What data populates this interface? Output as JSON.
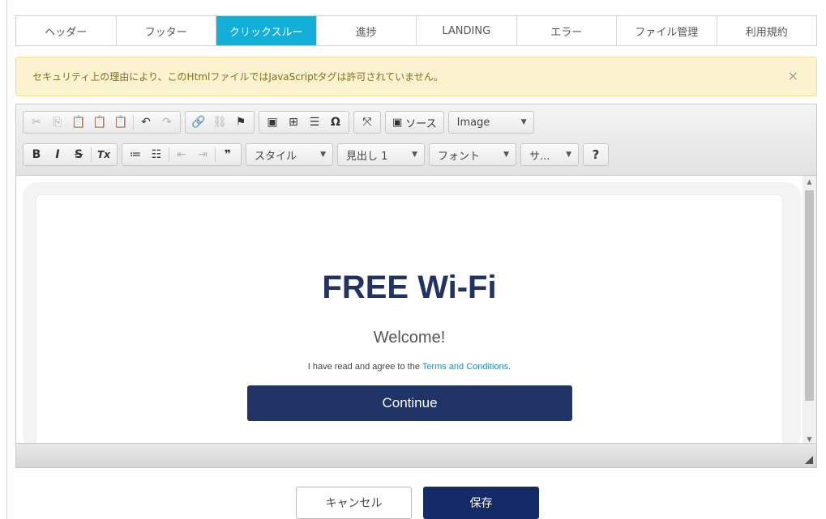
{
  "tabs": [
    {
      "label": "ヘッダー",
      "active": false
    },
    {
      "label": "フッター",
      "active": false
    },
    {
      "label": "クリックスルー",
      "active": true
    },
    {
      "label": "進捗",
      "active": false
    },
    {
      "label": "LANDING",
      "active": false
    },
    {
      "label": "エラー",
      "active": false
    },
    {
      "label": "ファイル管理",
      "active": false
    },
    {
      "label": "利用規約",
      "active": false
    }
  ],
  "alert": {
    "message": "セキュリティ上の理由により、このHtmlファイルではJavaScriptタグは許可されていません。",
    "close_glyph": "×"
  },
  "toolbar": {
    "source_label": "ソース",
    "image_select": "Image",
    "style_select": "スタイル",
    "heading_select": "見出し 1",
    "font_select": "フォント",
    "size_select": "サ...",
    "help_label": "?",
    "icons": {
      "cut": "✂",
      "copy": "⎘",
      "paste": "📋",
      "paste_text": "📋",
      "paste_word": "📋",
      "undo": "↶",
      "redo": "↷",
      "link": "🔗",
      "unlink": "⛓",
      "anchor": "⚑",
      "image": "▣",
      "table": "⊞",
      "hr": "☰",
      "special_char": "Ω",
      "maximize": "⤧",
      "bold": "B",
      "italic": "I",
      "strike": "S",
      "remove_format": "Tx",
      "numbered_list": "≔",
      "bulleted_list": "☷",
      "outdent": "⇤",
      "indent": "⇥",
      "blockquote": "❞"
    }
  },
  "content": {
    "hero_title": "FREE Wi-Fi",
    "welcome": "Welcome!",
    "agree_text": "I have read and agree to the ",
    "terms_link": "Terms and Conditions",
    "agree_period": ".",
    "continue_label": "Continue"
  },
  "footer_buttons": {
    "cancel": "キャンセル",
    "save": "保存"
  },
  "colors": {
    "active_tab": "#12b0d8",
    "alert_bg": "#fbf3cf",
    "hero": "#1f3366",
    "continue_bg": "#1f3366",
    "save_bg": "#132b66",
    "link": "#1b8fc4"
  }
}
